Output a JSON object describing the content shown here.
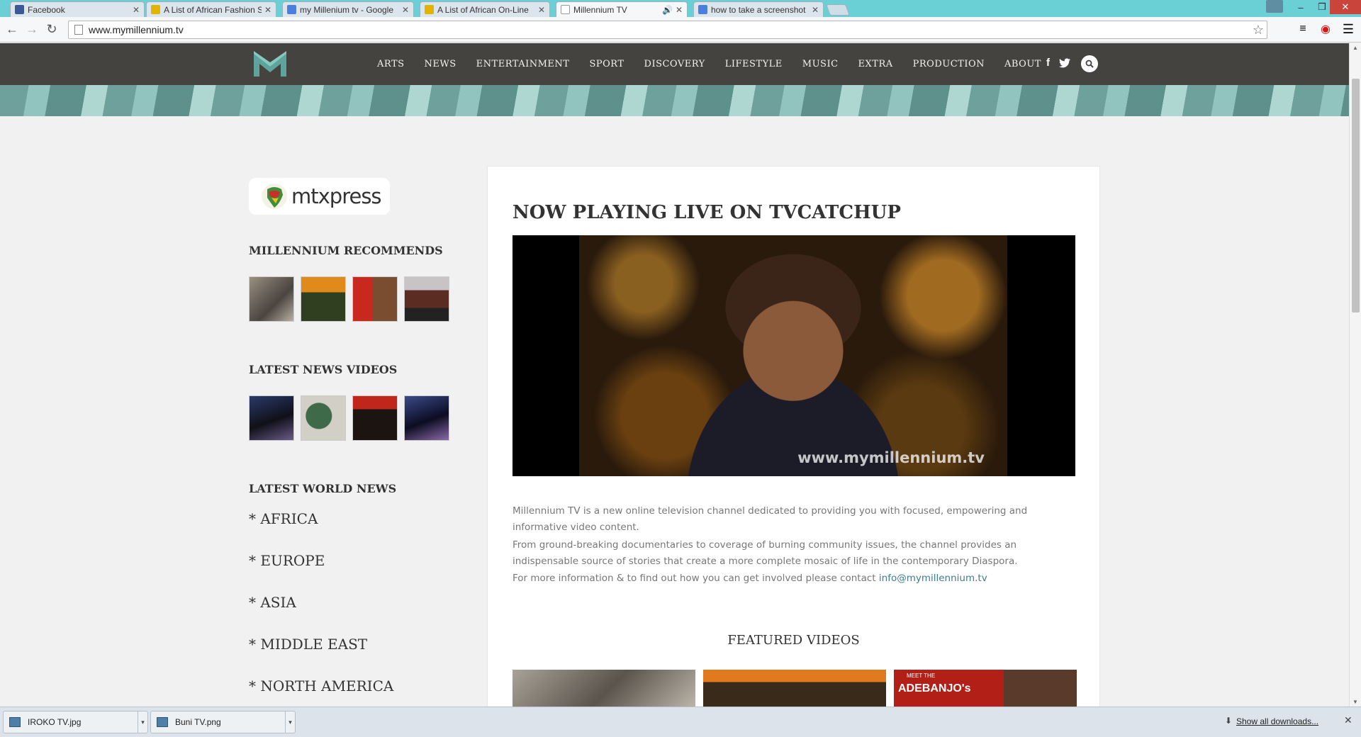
{
  "browser": {
    "tabs": [
      {
        "title": "Facebook",
        "favicon": "facebook-icon",
        "color": "#3b5998"
      },
      {
        "title": "A List of African Fashion S",
        "favicon": "crown-icon",
        "color": "#e2b400"
      },
      {
        "title": "my Millenium tv - Google",
        "favicon": "google-icon",
        "color": "#4a7fe0"
      },
      {
        "title": "A List of African On-Line",
        "favicon": "crown-icon",
        "color": "#e2b400"
      },
      {
        "title": "Millennium TV",
        "favicon": "page-icon",
        "color": "#ffffff",
        "active": true
      },
      {
        "title": "how to take a screenshot",
        "favicon": "google-icon",
        "color": "#4a7fe0"
      }
    ],
    "url": "www.mymillennium.tv",
    "window_controls": {
      "minimize": "‒",
      "restore": "❐",
      "close": "✕"
    }
  },
  "site": {
    "nav": [
      "ARTS",
      "NEWS",
      "ENTERTAINMENT",
      "SPORT",
      "DISCOVERY",
      "LIFESTYLE",
      "MUSIC",
      "EXTRA",
      "PRODUCTION",
      "ABOUT"
    ],
    "social": {
      "facebook": "f",
      "twitter": "🐦"
    },
    "accent": "#5fa49c",
    "header_bg": "#45433f"
  },
  "sidebar": {
    "mtxpress_label": "mtxpress",
    "recommends_title": "MILLENNIUM RECOMMENDS",
    "news_videos_title": "LATEST NEWS VIDEOS",
    "world_news_title": "LATEST WORLD NEWS",
    "world_news": [
      "* AFRICA",
      "* EUROPE",
      "* ASIA",
      "* MIDDLE EAST",
      "* NORTH AMERICA"
    ]
  },
  "main": {
    "heading": "NOW PLAYING LIVE ON TVCATCHUP",
    "watermark": "www.mymillennium.tv",
    "para1": "Millennium TV is a new online television channel dedicated to providing you with focused, empowering and informative video content.",
    "para2": "From ground-breaking documentaries to coverage of burning community issues, the channel provides an indispensable source of stories that create a more complete mosaic of life in the contemporary Diaspora.",
    "para3_prefix": "For more information & to find out how you can get involved please contact ",
    "contact_email": "info@mymillennium.tv",
    "featured_title": "FEATURED VIDEOS",
    "featured_badge": "ADEBANJO's",
    "featured_badge_top": "MEET THE"
  },
  "downloads": {
    "items": [
      "IROKO TV.jpg",
      "Buni TV.png"
    ],
    "show_all": "Show all downloads..."
  }
}
